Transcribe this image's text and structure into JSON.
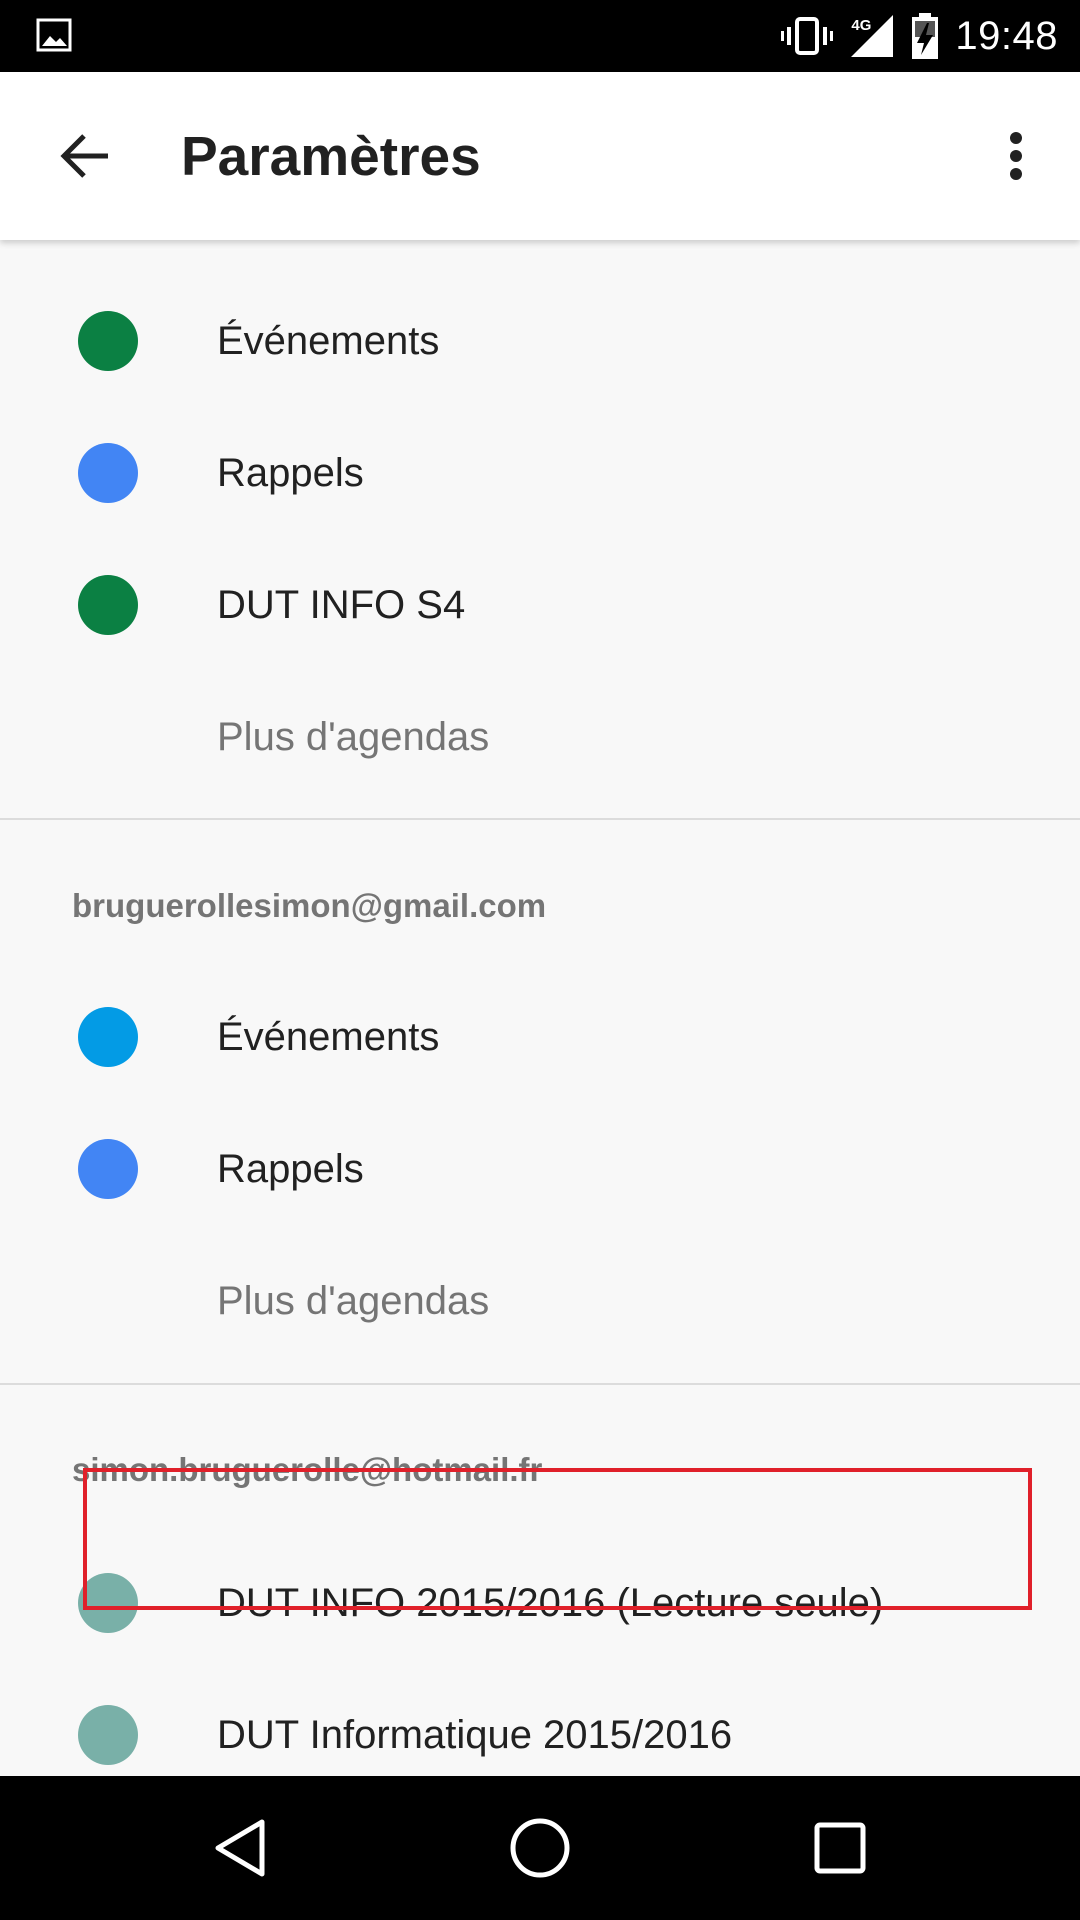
{
  "status_bar": {
    "time": "19:48",
    "network": "4G",
    "icons": [
      "gallery-icon",
      "vibrate-icon",
      "signal-icon",
      "battery-charging-icon"
    ]
  },
  "app_bar": {
    "title": "Paramètres",
    "back_icon": "arrow-back-icon",
    "overflow_icon": "more-vert-icon"
  },
  "sections": [
    {
      "account": "",
      "calendars": [
        {
          "label": "Événements",
          "color": "#0b8043"
        },
        {
          "label": "Rappels",
          "color": "#4285f4"
        },
        {
          "label": "DUT INFO S4",
          "color": "#0b8043"
        }
      ],
      "more_label": "Plus d'agendas"
    },
    {
      "account": "bruguerollesimon@gmail.com",
      "calendars": [
        {
          "label": "Événements",
          "color": "#039be5"
        },
        {
          "label": "Rappels",
          "color": "#4285f4"
        }
      ],
      "more_label": "Plus d'agendas"
    },
    {
      "account": "simon.bruguerolle@hotmail.fr",
      "calendars": [
        {
          "label": "DUT INFO 2015/2016 (Lecture seule)",
          "color": "#79b0a8"
        },
        {
          "label": "DUT Informatique 2015/2016",
          "color": "#79b0a8"
        }
      ]
    }
  ],
  "highlight_color": "#e0202a",
  "nav_bar": {
    "icons": [
      "back-triangle-icon",
      "home-circle-icon",
      "recents-square-icon"
    ]
  }
}
